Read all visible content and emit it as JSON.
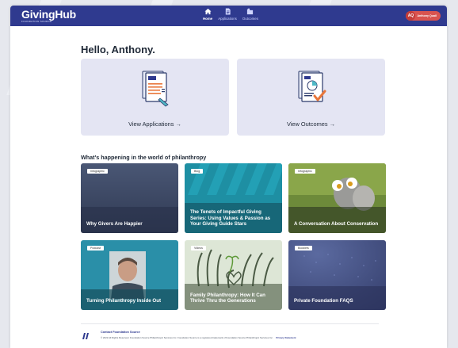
{
  "brand": {
    "name": "GivingHub",
    "tagline": "FOUNDATION SOURCE"
  },
  "nav": {
    "items": [
      {
        "label": "Home",
        "icon": "home-icon",
        "active": true
      },
      {
        "label": "Applications",
        "icon": "document-icon",
        "active": false
      },
      {
        "label": "Outcomes",
        "icon": "outcomes-icon",
        "active": false
      }
    ]
  },
  "user": {
    "initials": "AQ",
    "name": "Anthony Quail"
  },
  "greeting": "Hello, Anthony.",
  "cards": [
    {
      "label": "View Applications →",
      "icon": "applications-document-icon"
    },
    {
      "label": "View Outcomes →",
      "icon": "outcomes-chart-icon"
    }
  ],
  "section_title": "What's happening in the world of philanthropy",
  "tiles": [
    {
      "tag": "Infographic",
      "title": "Why Givers Are Happier"
    },
    {
      "tag": "Blog",
      "title": "The Tenets of Impactful Giving Series: Using Values & Passion as Your Giving Guide Stars"
    },
    {
      "tag": "Infographic",
      "title": "A Conversation About Conservation"
    },
    {
      "tag": "Podcast",
      "title": "Turning Philanthropy Inside Out"
    },
    {
      "tag": "Videos",
      "title": "Family Philanthropy: How It Can Thrive Thru the Generations"
    },
    {
      "tag": "Booklets",
      "title": "Private Foundation FAQS"
    }
  ],
  "footer": {
    "title": "Contact Foundation Source",
    "copyright": "© 2022 All Rights Reserved. Foundation Source Philanthropic Services Inc. Foundation Source is a registered trademark of Foundation Source Philanthropic Services Inc.",
    "privacy": "Privacy Statement"
  },
  "colors": {
    "header": "#2f3a8f",
    "accent": "#d9534f",
    "card_bg": "#e4e5f3"
  }
}
